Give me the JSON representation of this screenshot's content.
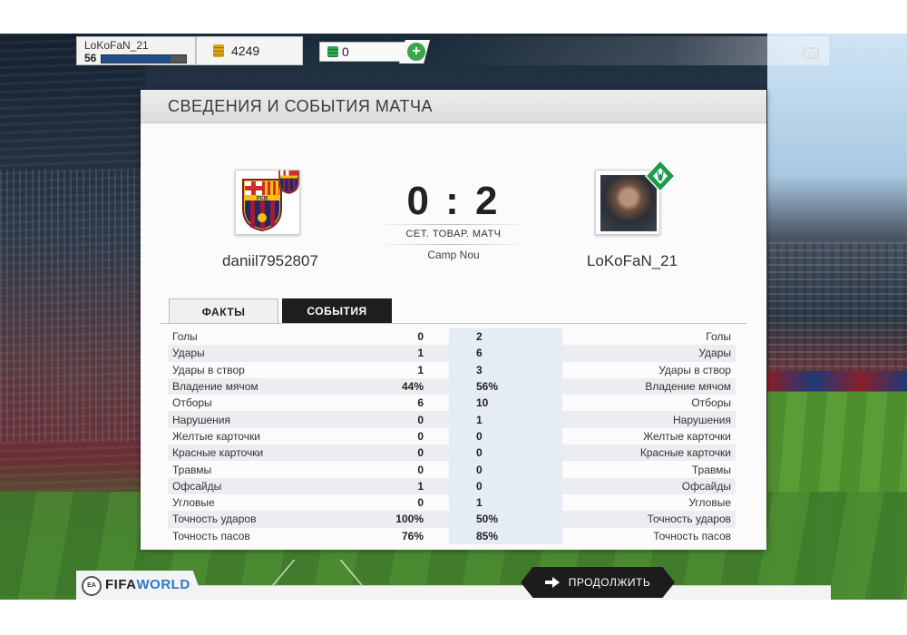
{
  "hud": {
    "player_name": "LoKoFaN_21",
    "level": "56",
    "xp_progress": 0.82,
    "coins": "4249",
    "points": "0",
    "add_label": "+"
  },
  "panel": {
    "title": "СВЕДЕНИЯ И СОБЫТИЯ МАТЧА",
    "home": {
      "name": "daniil7952807",
      "badge_text": "FCB"
    },
    "away": {
      "name": "LoKoFaN_21"
    },
    "score": "0 : 2",
    "match_type": "СЕТ. ТОВАР. МАТЧ",
    "venue": "Camp Nou",
    "tabs": [
      {
        "label": "ФАКТЫ",
        "active": true
      },
      {
        "label": "СОБЫТИЯ",
        "active": false
      }
    ],
    "stats": [
      {
        "label": "Голы",
        "home": "0",
        "away": "2"
      },
      {
        "label": "Удары",
        "home": "1",
        "away": "6"
      },
      {
        "label": "Удары в створ",
        "home": "1",
        "away": "3"
      },
      {
        "label": "Владение мячом",
        "home": "44%",
        "away": "56%"
      },
      {
        "label": "Отборы",
        "home": "6",
        "away": "10"
      },
      {
        "label": "Нарушения",
        "home": "0",
        "away": "1"
      },
      {
        "label": "Желтые карточки",
        "home": "0",
        "away": "0"
      },
      {
        "label": "Красные карточки",
        "home": "0",
        "away": "0"
      },
      {
        "label": "Травмы",
        "home": "0",
        "away": "0"
      },
      {
        "label": "Офсайды",
        "home": "1",
        "away": "0"
      },
      {
        "label": "Угловые",
        "home": "0",
        "away": "1"
      },
      {
        "label": "Точность ударов",
        "home": "100%",
        "away": "50%"
      },
      {
        "label": "Точность пасов",
        "home": "76%",
        "away": "85%"
      }
    ]
  },
  "footer": {
    "logo_ea": "EA",
    "logo_fifa": "FIFA",
    "logo_world": "WORLD",
    "continue_label": "ПРОДОЛЖИТЬ"
  },
  "icons": [
    "coin-icon",
    "points-icon",
    "plus-icon",
    "camera-icon",
    "arrow-right-icon",
    "ea-sports-logo"
  ],
  "colors": {
    "accent_green": "#3aa54a",
    "xp_blue": "#1f4e8c",
    "dark_tab": "#1e1e1e",
    "fifa_blue": "#2a78c8"
  }
}
